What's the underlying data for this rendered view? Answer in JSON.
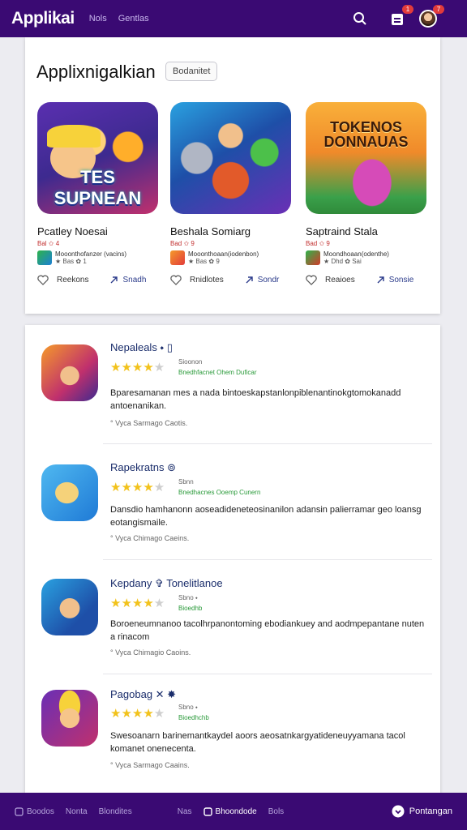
{
  "topbar": {
    "brand": "Applikai",
    "nav": [
      "Nols",
      "Gentlas"
    ],
    "notif_badge": "1",
    "cart_badge": "7",
    "icons": [
      "search-icon",
      "inbox-icon",
      "avatar"
    ]
  },
  "featured": {
    "title": "Applixnigalkian",
    "chip": "Bodanitet",
    "games": [
      {
        "art_text": "TES SUPNEAN",
        "name": "Pcatley Noesai",
        "meta": "Bal ✩ 4",
        "dev_line1": "Mooonthofanzer (vacins)",
        "dev_line2": "★ Bas ✿ 1",
        "like": "Reekons",
        "share": "Snadh",
        "colors": [
          "#3d2a8f",
          "#c0306d"
        ]
      },
      {
        "art_text": "",
        "name": "Beshala Somiarg",
        "meta": "Bad ✩ 9",
        "dev_line1": "Mooonthoaan(iodenbon)",
        "dev_line2": "★ Bas ✿ 9",
        "like": "Rnidlotes",
        "share": "Sondr",
        "colors": [
          "#1e4fa8",
          "#6a2fb5"
        ]
      },
      {
        "art_text": "TOKENOS DONNAUAS",
        "name": "Saptraind Stala",
        "meta": "Bad ✩ 9",
        "dev_line1": "Moondhoaan(odenthe)",
        "dev_line2": "★ Dhd ✿ Sai",
        "like": "Reaioes",
        "share": "Sonsie",
        "colors": [
          "#f59a2a",
          "#d2462a"
        ]
      }
    ]
  },
  "list": [
    {
      "name": "Nepaleals ⬩ ▯",
      "rating": 4,
      "rating_text": "Sioonon",
      "rating_sub": "Bnedhfacnet Ohem Duficar",
      "desc": "Bparesamanan mes a nada bintoeskapstanlonpiblenantinokgtomokanadd antoenanikan.",
      "foot": "° Vyca Sarmago Caotis."
    },
    {
      "name": "Rapekratns ⊚",
      "rating": 4,
      "rating_text": "Sbnn",
      "rating_sub": "Bnedhacnes Ooemp Cunern",
      "desc": "Dansdio hamhanonn aoseadideneteosinanilon adansin palierramar geo loansg eotangismaile.",
      "foot": "° Vyca Chimago Caeins."
    },
    {
      "name": "Kepdany ✞ Tonelitlanoe",
      "rating": 4,
      "rating_text": "Sbno ⬩",
      "rating_sub": "Bioedhb",
      "desc": "Boroeneumnanoo tacolhrpanontoming ebodiankuey and aodmpepantane nuten a rinacom",
      "foot": "° Vyca Chimagio Caoins."
    },
    {
      "name": "Pagobag ✕ ✸",
      "rating": 4,
      "rating_text": "Sbno ⬩",
      "rating_sub": "Bioedhchb",
      "desc": "Swesoanarn barinemantkaydel aoors aeosatnkargyatideneuyyamana tacol komanet onenecenta.",
      "foot": "° Vyca Sarmago Caains."
    }
  ],
  "bottombar": {
    "items": [
      "Boodos",
      "Nonta",
      "Blondites",
      "Nas",
      "Bhoondode",
      "Bols"
    ],
    "active_index": 4,
    "cta": "Pontangan"
  }
}
